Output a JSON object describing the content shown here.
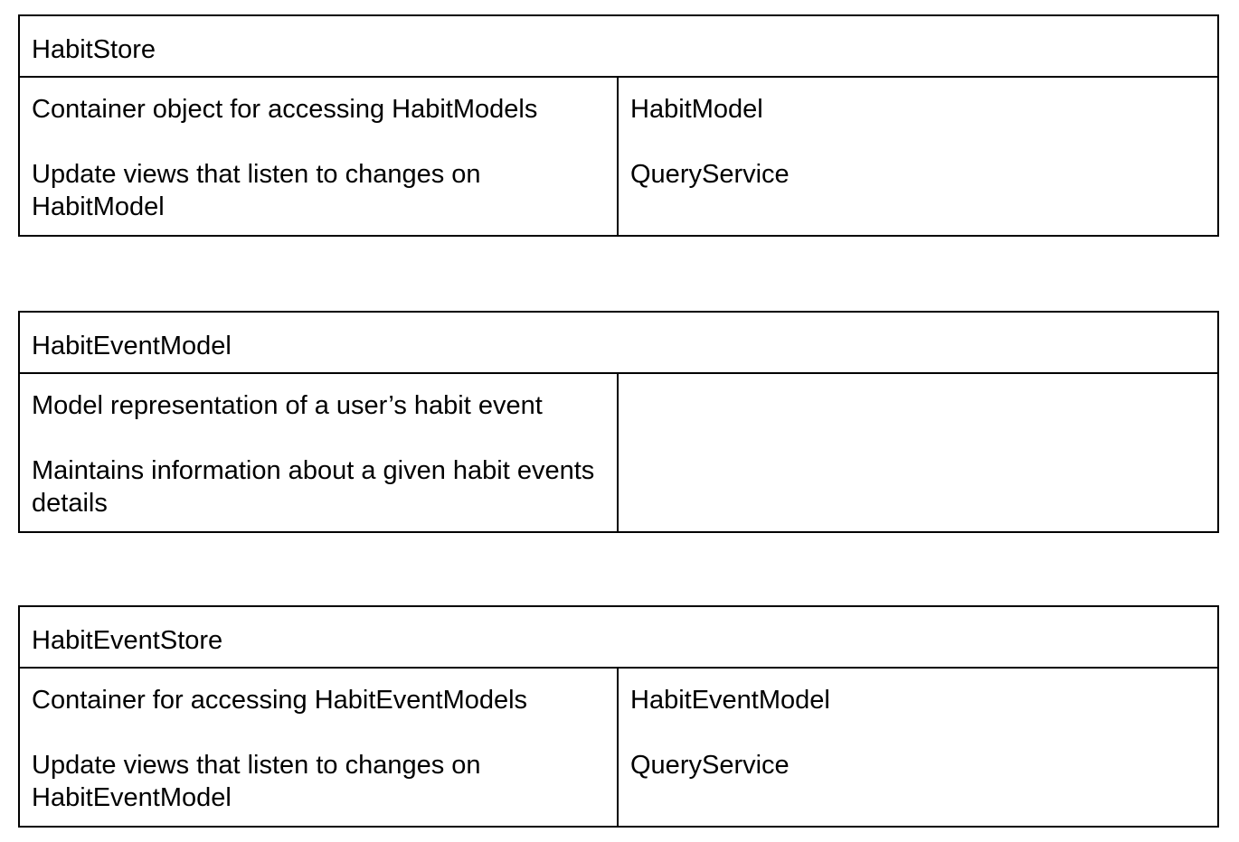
{
  "cards": [
    {
      "class_name": "HabitStore",
      "responsibilities": [
        "Container object for accessing HabitModels",
        "Update views that listen to changes on HabitModel"
      ],
      "collaborators": [
        "HabitModel",
        "QueryService"
      ]
    },
    {
      "class_name": "HabitEventModel",
      "responsibilities": [
        "Model representation of a user’s habit event",
        "Maintains information about a given habit events details"
      ],
      "collaborators": []
    },
    {
      "class_name": "HabitEventStore",
      "responsibilities": [
        "Container for accessing HabitEventModels",
        "Update views that listen to changes on HabitEventModel"
      ],
      "collaborators": [
        "HabitEventModel",
        "QueryService"
      ]
    }
  ]
}
